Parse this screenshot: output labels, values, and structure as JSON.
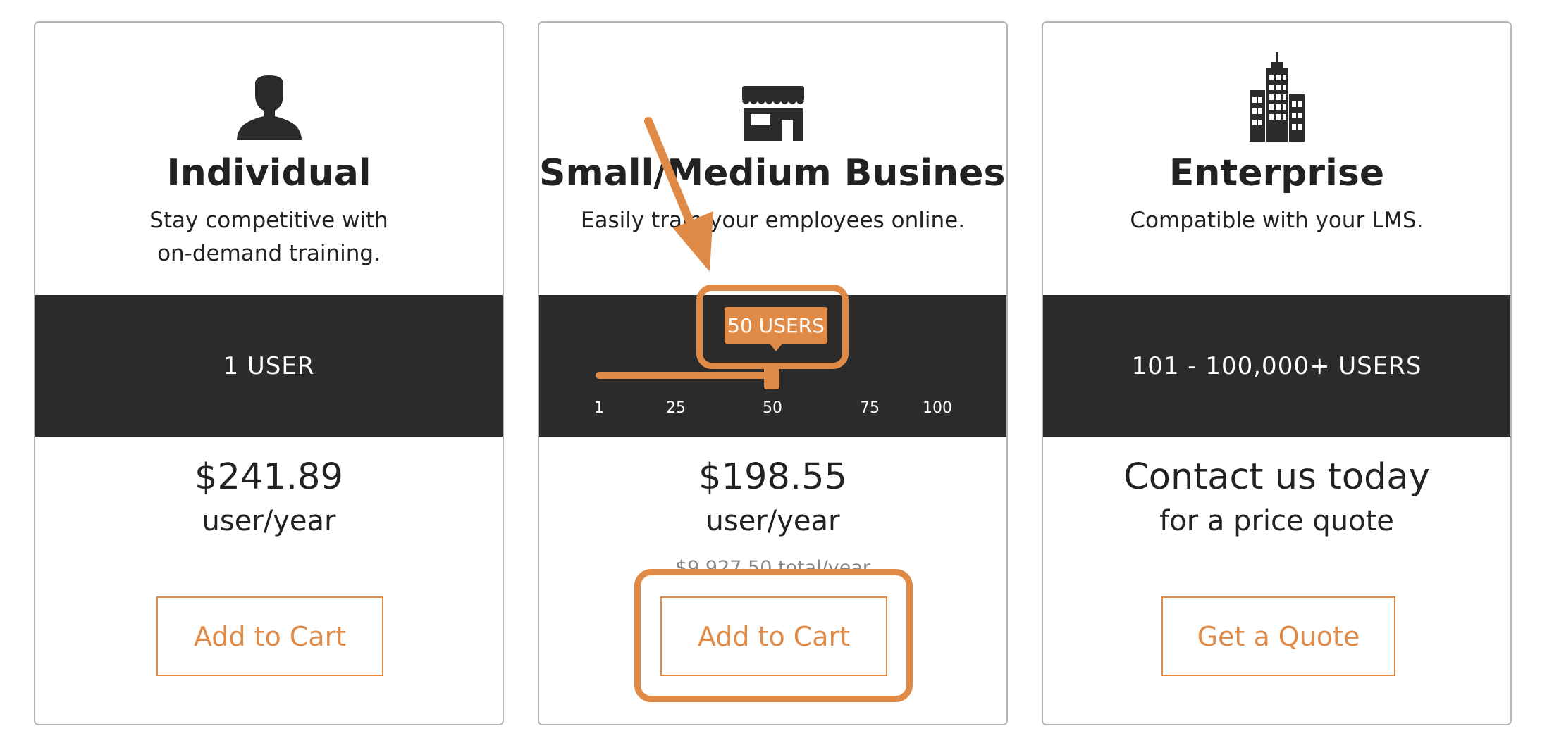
{
  "plans": {
    "individual": {
      "icon": "person-icon",
      "title": "Individual",
      "description_line1": "Stay competitive with",
      "description_line2": "on-demand training.",
      "users": "1 USER",
      "price": "$241.89",
      "price_unit": "user/year",
      "button": "Add to Cart"
    },
    "smb": {
      "icon": "storefront-icon",
      "title": "Small/Medium Business",
      "description": "Easily train your employees online.",
      "slider": {
        "tooltip": "50 USERS",
        "value": 50,
        "min": 1,
        "max": 100,
        "ticks": [
          "1",
          "25",
          "50",
          "75",
          "100"
        ]
      },
      "price": "$198.55",
      "price_unit": "user/year",
      "total": "$9,927.50 total/year",
      "button": "Add to Cart"
    },
    "enterprise": {
      "icon": "office-building-icon",
      "title": "Enterprise",
      "description": "Compatible with your LMS.",
      "users": "101 - 100,000+ USERS",
      "price": "Contact us today",
      "price_unit": "for a price quote",
      "button": "Get a Quote"
    }
  },
  "colors": {
    "accent": "#e08a47",
    "band": "#2b2b2b",
    "text": "#222222",
    "muted": "#888888",
    "border": "#b5b5b5"
  }
}
